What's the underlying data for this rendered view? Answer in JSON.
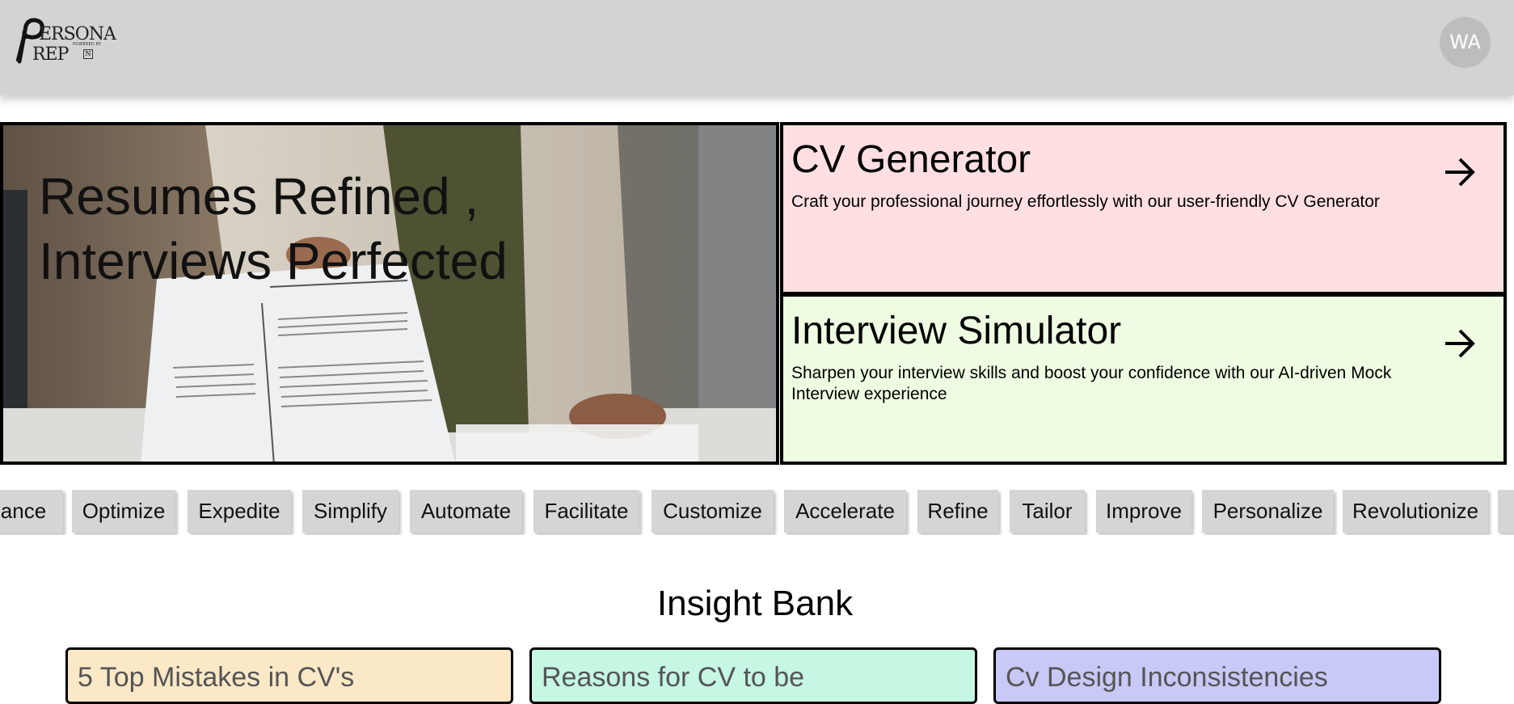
{
  "header": {
    "logo": {
      "line1": "ERSONA",
      "line2": "REP",
      "powered_by": "POWERED BY",
      "badge": "N"
    },
    "avatar_initials": "WA"
  },
  "hero": {
    "title_line1": "Resumes Refined ,",
    "title_line2": "Interviews Perfected",
    "image_icon": "resume-handover-photo"
  },
  "features": [
    {
      "title": "CV Generator",
      "description": "Craft your professional journey effortlessly with our user-friendly CV Generator",
      "icon": "arrow-right-icon",
      "bg": "#ffdfe2"
    },
    {
      "title": "Interview Simulator",
      "description": "Sharpen your interview skills and boost your confidence with our AI-driven Mock Interview experience",
      "icon": "arrow-right-icon",
      "bg": "#eefde2"
    }
  ],
  "chips": [
    "ance",
    "Optimize",
    "Expedite",
    "Simplify",
    "Automate",
    "Facilitate",
    "Customize",
    "Accelerate",
    "Refine",
    "Tailor",
    "Improve",
    "Personalize",
    "Revolutionize",
    ""
  ],
  "insight_bank": {
    "title": "Insight Bank",
    "cards": [
      {
        "title": "5 Top Mistakes in CV's",
        "bg": "#fae8c7"
      },
      {
        "title": "Reasons for CV to be",
        "bg": "#c5f7e3"
      },
      {
        "title": "Cv Design Inconsistencies",
        "bg": "#c8c9f7"
      }
    ]
  }
}
